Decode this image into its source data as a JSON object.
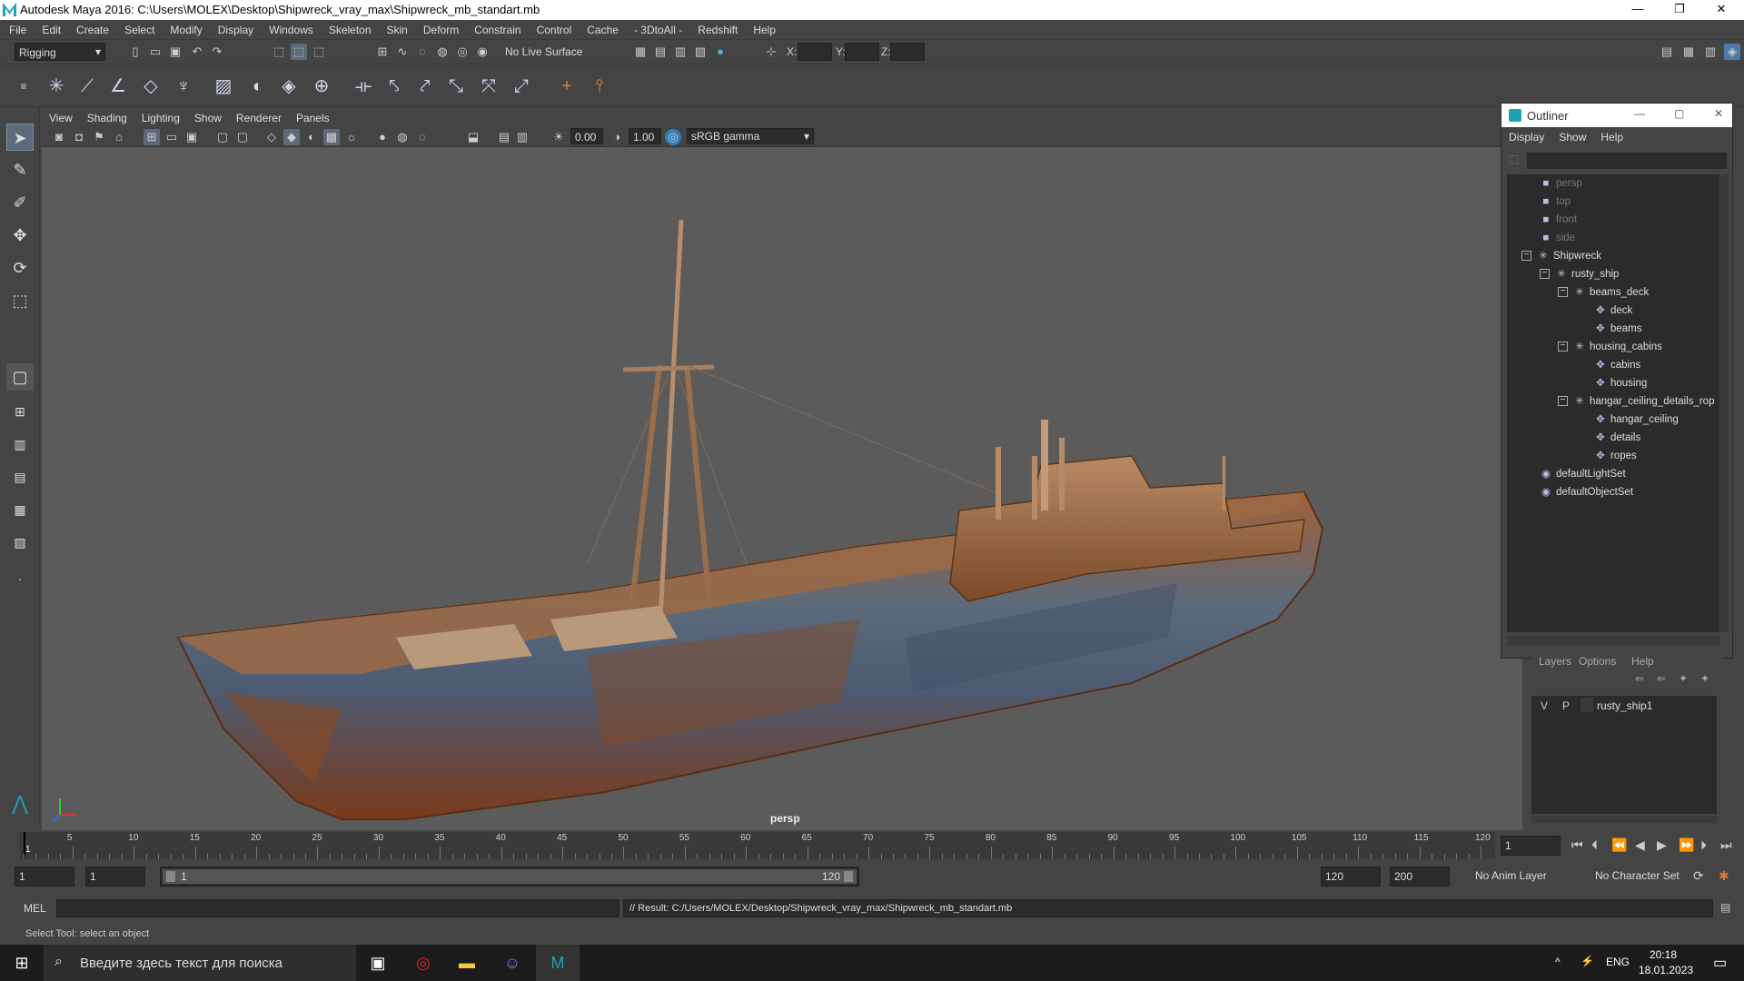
{
  "window": {
    "title": "Autodesk Maya 2016: C:\\Users\\MOLEX\\Desktop\\Shipwreck_vray_max\\Shipwreck_mb_standart.mb",
    "controls": {
      "minimize": "—",
      "restore": "❐",
      "close": "✕"
    }
  },
  "menubar": [
    "File",
    "Edit",
    "Create",
    "Select",
    "Modify",
    "Display",
    "Windows",
    "Skeleton",
    "Skin",
    "Deform",
    "Constrain",
    "Control",
    "Cache",
    "- 3DtoAll -",
    "Redshift",
    "Help"
  ],
  "statusline": {
    "mode": "Rigging",
    "live_surface": "No Live Surface",
    "x_label": "X:",
    "y_label": "Y:",
    "z_label": "Z:"
  },
  "viewport": {
    "menu": [
      "View",
      "Shading",
      "Lighting",
      "Show",
      "Renderer",
      "Panels"
    ],
    "exposure": "0.00",
    "gamma": "1.00",
    "color_space": "sRGB gamma",
    "camera_label": "persp"
  },
  "outliner": {
    "title": "Outliner",
    "menu": [
      "Display",
      "Show",
      "Help"
    ],
    "nodes": [
      {
        "label": "persp",
        "icon": "camera-icon"
      },
      {
        "label": "top",
        "icon": "camera-icon"
      },
      {
        "label": "front",
        "icon": "camera-icon"
      },
      {
        "label": "side",
        "icon": "camera-icon"
      },
      {
        "label": "Shipwreck",
        "icon": "group-icon"
      },
      {
        "label": "rusty_ship",
        "icon": "group-icon"
      },
      {
        "label": "beams_deck",
        "icon": "group-icon"
      },
      {
        "label": "deck",
        "icon": "mesh-icon"
      },
      {
        "label": "beams",
        "icon": "mesh-icon"
      },
      {
        "label": "housing_cabins",
        "icon": "group-icon"
      },
      {
        "label": "cabins",
        "icon": "mesh-icon"
      },
      {
        "label": "housing",
        "icon": "mesh-icon"
      },
      {
        "label": "hangar_ceiling_details_rop",
        "icon": "group-icon"
      },
      {
        "label": "hangar_ceiling",
        "icon": "mesh-icon"
      },
      {
        "label": "details",
        "icon": "mesh-icon"
      },
      {
        "label": "ropes",
        "icon": "mesh-icon"
      },
      {
        "label": "defaultLightSet",
        "icon": "set-icon"
      },
      {
        "label": "defaultObjectSet",
        "icon": "set-icon"
      }
    ]
  },
  "layers": {
    "tabs": [
      "Layers",
      "Options",
      "Help"
    ],
    "rows": [
      {
        "v": "V",
        "p": "P",
        "name": "rusty_ship1"
      }
    ]
  },
  "timeline": {
    "labels": [
      "5",
      "10",
      "15",
      "20",
      "25",
      "30",
      "35",
      "40",
      "45",
      "50",
      "55",
      "60",
      "65",
      "70",
      "75",
      "80",
      "85",
      "90",
      "95",
      "100",
      "105",
      "110",
      "115",
      "120"
    ],
    "start_label": "1",
    "current_frame": "1"
  },
  "range": {
    "start": "1",
    "playback_start": "1",
    "slider_start": "1",
    "slider_end": "120",
    "playback_end": "120",
    "end": "200",
    "anim_layer": "No Anim Layer",
    "character_set": "No Character Set"
  },
  "command": {
    "mel_label": "MEL",
    "result": "// Result: C:/Users/MOLEX/Desktop/Shipwreck_vray_max/Shipwreck_mb_standart.mb",
    "help": "Select Tool: select an object"
  },
  "taskbar": {
    "search_placeholder": "Введите здесь текст для поиска",
    "lang": "ENG",
    "time": "20:18",
    "date": "18.01.2023"
  },
  "colors": {
    "accent": "#5c6a7a",
    "rust": "#8a4a22",
    "viewport_bg": "#5b5b5b"
  }
}
